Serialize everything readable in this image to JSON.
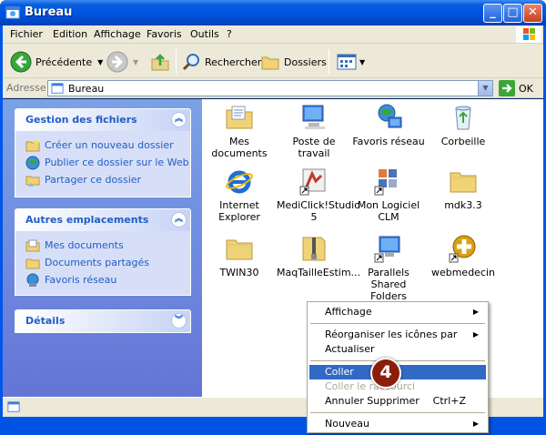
{
  "window": {
    "title": "Bureau"
  },
  "menu": [
    "Fichier",
    "Edition",
    "Affichage",
    "Favoris",
    "Outils",
    "?"
  ],
  "toolbar": {
    "back": "Précédente",
    "search": "Rechercher",
    "folders": "Dossiers"
  },
  "address": {
    "label": "Adresse",
    "value": "Bureau",
    "go": "OK"
  },
  "tasks": {
    "file_tasks": {
      "title": "Gestion des fichiers",
      "links": [
        "Créer un nouveau dossier",
        "Publier ce dossier sur le Web",
        "Partager ce dossier"
      ]
    },
    "other_places": {
      "title": "Autres emplacements",
      "links": [
        "Mes documents",
        "Documents partagés",
        "Favoris réseau"
      ]
    },
    "details": {
      "title": "Détails"
    }
  },
  "desktop_items": [
    [
      "Mes documents"
    ],
    [
      "Poste de travail"
    ],
    [
      "Favoris réseau"
    ],
    [
      "Corbeille"
    ],
    [
      "Internet",
      "Explorer"
    ],
    [
      "MediClick!Studio",
      "5"
    ],
    [
      "Mon Logiciel CLM"
    ],
    [
      "mdk3.3"
    ],
    [
      "TWIN30"
    ],
    [
      "MaqTailleEstim..."
    ],
    [
      "Parallels Shared",
      "Folders"
    ],
    [
      "webmedecin"
    ]
  ],
  "context_menu": {
    "view": "Affichage",
    "arrange": "Réorganiser les icônes par",
    "refresh": "Actualiser",
    "paste": "Coller",
    "paste_shortcut": "Coller le raccourci",
    "undo": "Annuler Supprimer",
    "undo_shortcut": "Ctrl+Z",
    "new": "Nouveau"
  },
  "annotation": {
    "step": "4"
  },
  "colors": {
    "titlebar": "#0054e3",
    "task_pane": "#6375d6",
    "selection": "#316ac5",
    "badge": "#8b1d0c"
  }
}
